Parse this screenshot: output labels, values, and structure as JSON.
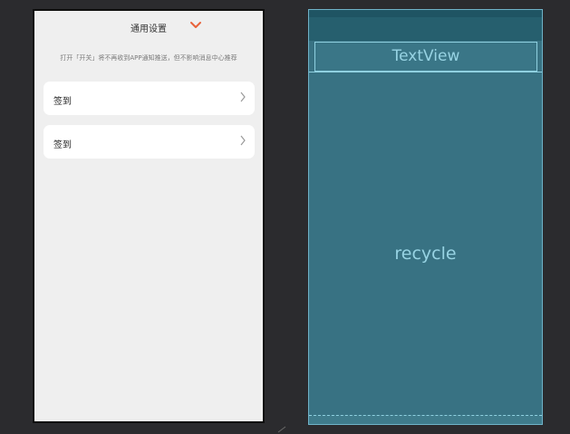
{
  "preview": {
    "header": {
      "title": "通用设置",
      "chevron_icon": "chevron-down-icon",
      "chevron_color": "#e8623a"
    },
    "notice": "打开「开关」将不再收到APP通知推送，但不影响消息中心推荐",
    "rows": [
      {
        "label": "签到",
        "arrow_icon": "chevron-right-icon"
      },
      {
        "label": "签到",
        "arrow_icon": "chevron-right-icon"
      }
    ],
    "background_color": "#efefef"
  },
  "blueprint": {
    "textview_label": "TextView",
    "recycle_label": "recycle",
    "fill_color": "#387283",
    "outline_color": "#8fd0e0"
  },
  "canvas_background": "#2b2b2e"
}
